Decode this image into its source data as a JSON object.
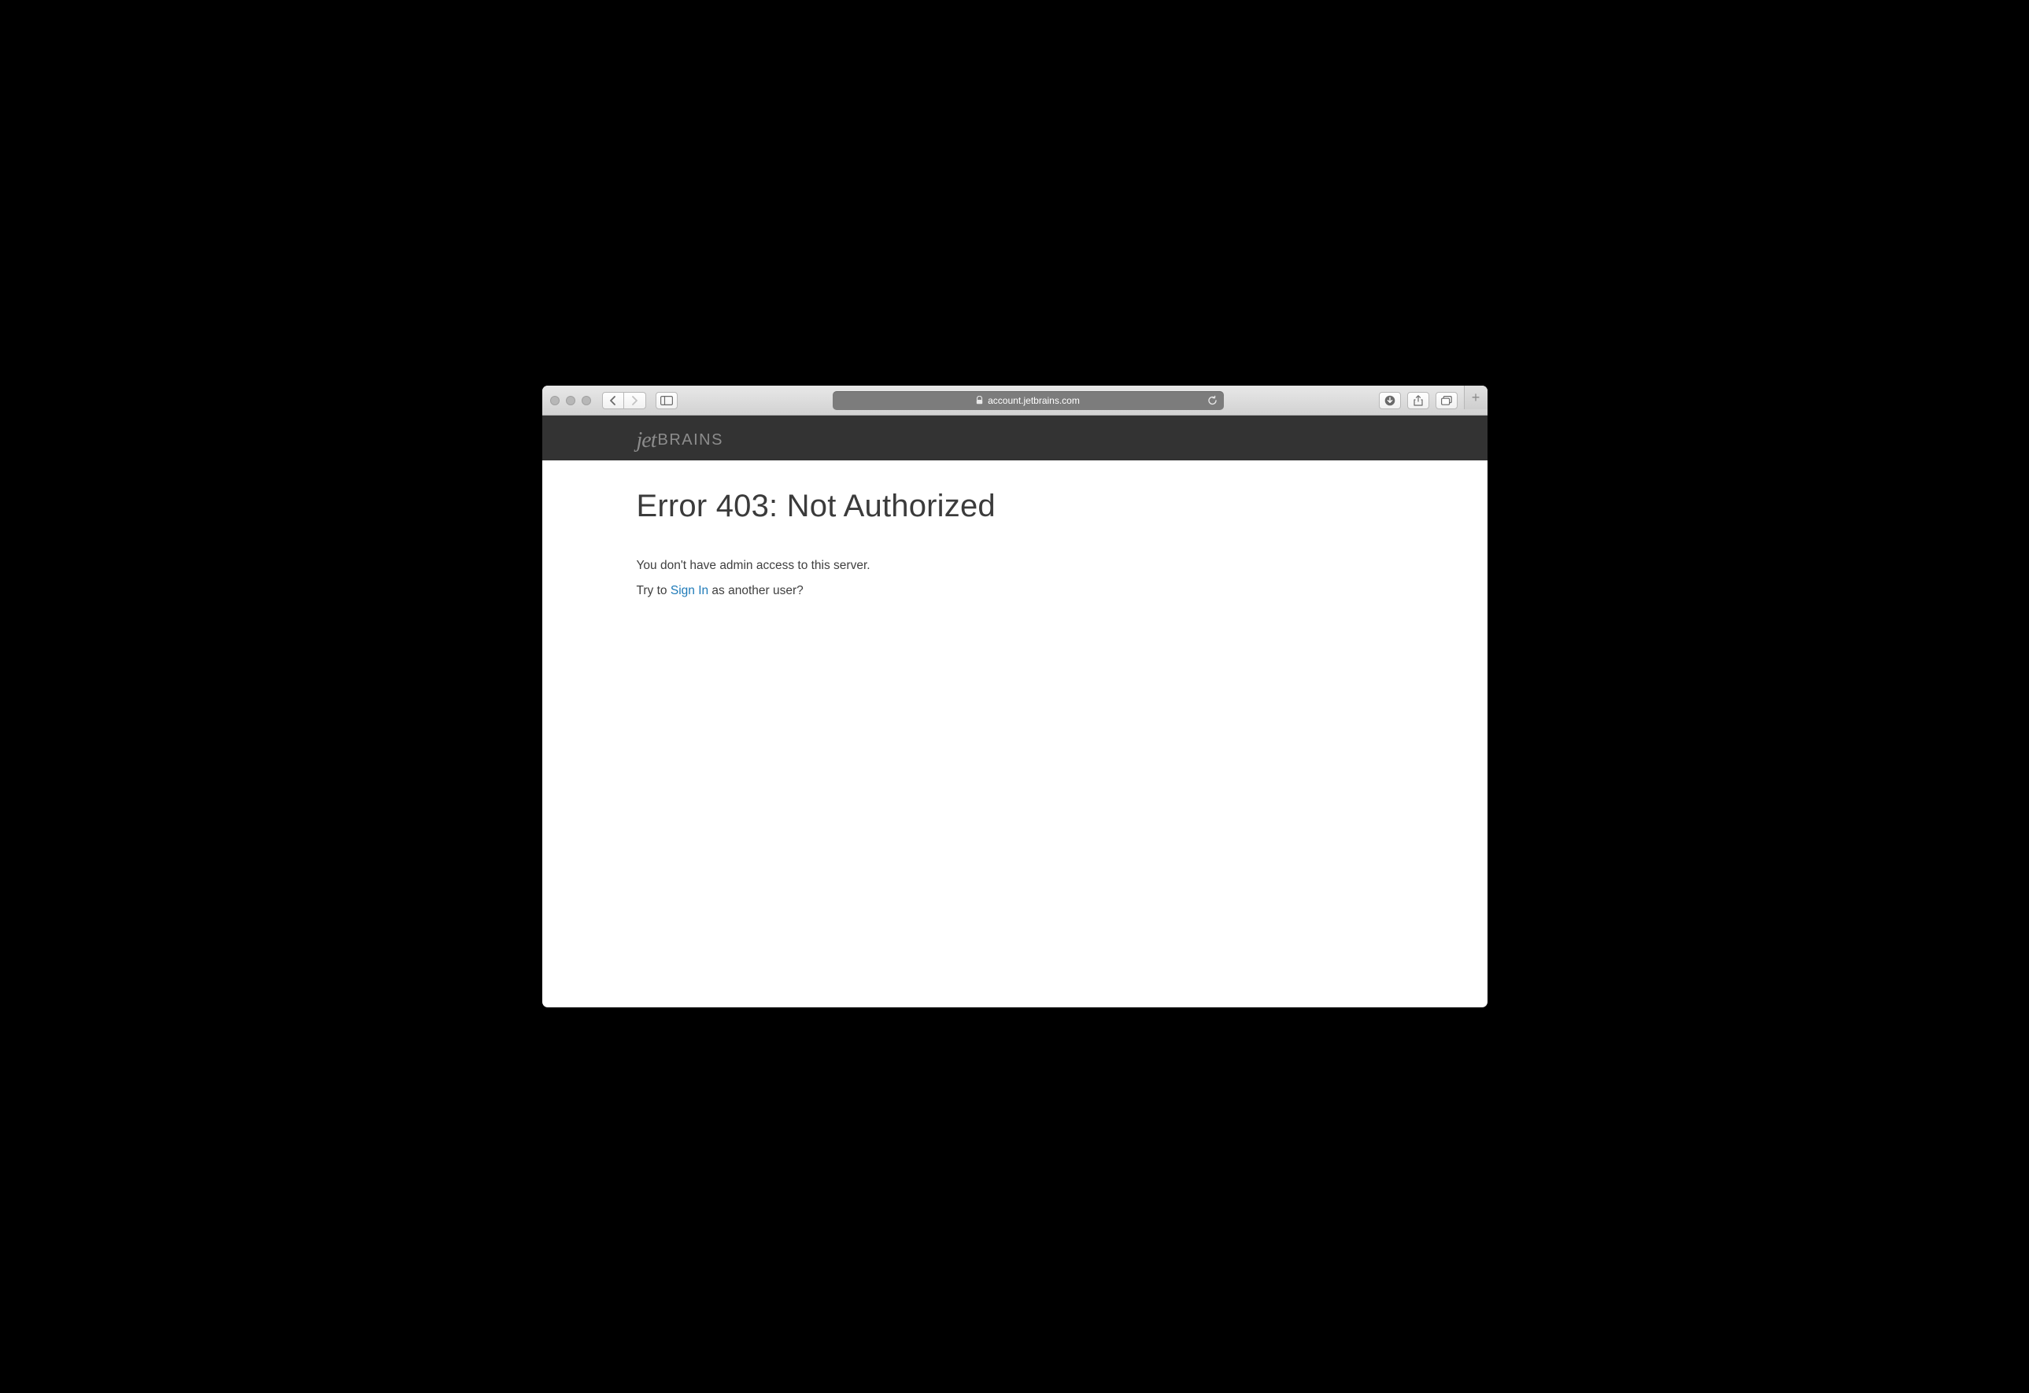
{
  "browser": {
    "url_host": "account.jetbrains.com"
  },
  "header": {
    "logo_script": "jet",
    "logo_block": "BRAINS"
  },
  "error": {
    "title": "Error 403: Not Authorized",
    "message": "You don't have admin access to this server.",
    "prompt_prefix": "Try to ",
    "signin_label": "Sign In",
    "prompt_suffix": " as another user?"
  }
}
